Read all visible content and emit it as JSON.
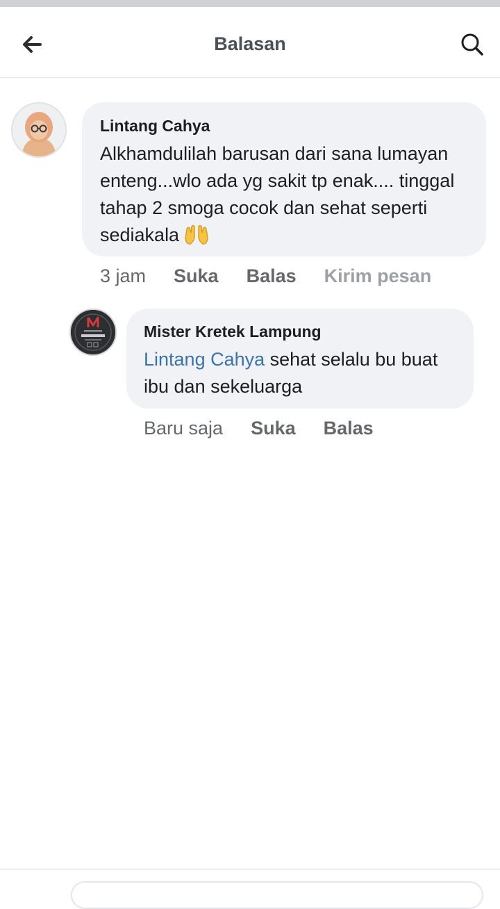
{
  "header": {
    "title": "Balasan",
    "back_icon": "arrow-left-icon",
    "search_icon": "search-icon"
  },
  "comment": {
    "author": "Lintang Cahya",
    "text": "Alkhamdulilah barusan dari sana lumayan enteng...wlo ada yg sakit tp enak.... tinggal tahap 2 smoga cocok dan sehat seperti sediakala",
    "emoji": "raised-hands-icon",
    "time": "3 jam",
    "actions": {
      "like": "Suka",
      "reply": "Balas",
      "message": "Kirim pesan"
    }
  },
  "reply": {
    "author": "Mister Kretek Lampung",
    "mention": "Lintang Cahya",
    "text": " sehat selalu bu buat ibu dan sekeluarga",
    "time": "Baru saja",
    "actions": {
      "like": "Suka",
      "reply": "Balas"
    }
  },
  "colors": {
    "bubble": "#f0f2f5",
    "mention": "#3a74b0",
    "secondary_text": "#65676b",
    "muted_text": "#9da0a6"
  }
}
